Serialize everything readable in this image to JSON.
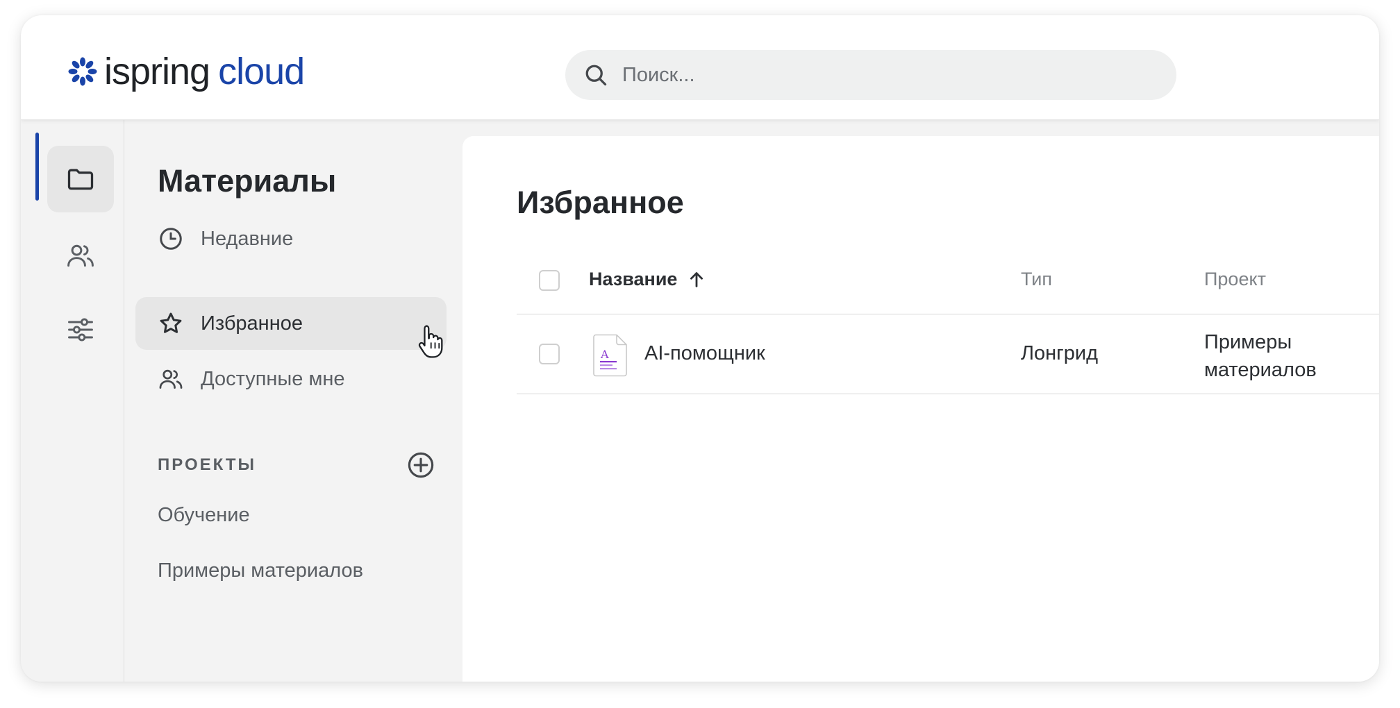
{
  "brand": {
    "part1": "ispring",
    "part2": "cloud",
    "accent": "#1a44a8"
  },
  "search": {
    "placeholder": "Поиск..."
  },
  "rail": {
    "items": [
      {
        "icon": "folder-icon",
        "active": true
      },
      {
        "icon": "users-icon",
        "active": false
      },
      {
        "icon": "sliders-icon",
        "active": false
      }
    ]
  },
  "sidebar": {
    "title": "Материалы",
    "nav": [
      {
        "label": "Недавние",
        "icon": "clock-icon"
      },
      {
        "label": "Избранное",
        "icon": "star-icon",
        "active": true
      },
      {
        "label": "Доступные мне",
        "icon": "users-icon"
      }
    ],
    "projects_title": "ПРОЕКТЫ",
    "projects": [
      "Обучение",
      "Примеры материалов"
    ]
  },
  "main": {
    "title": "Избранное",
    "table": {
      "columns": {
        "name": "Название",
        "type": "Тип",
        "project": "Проект"
      },
      "sort": {
        "column": "name",
        "direction": "asc"
      },
      "rows": [
        {
          "name": "AI-помощник",
          "type": "Лонгрид",
          "project": "Примеры материалов",
          "icon": "longread-file-icon"
        }
      ]
    }
  }
}
